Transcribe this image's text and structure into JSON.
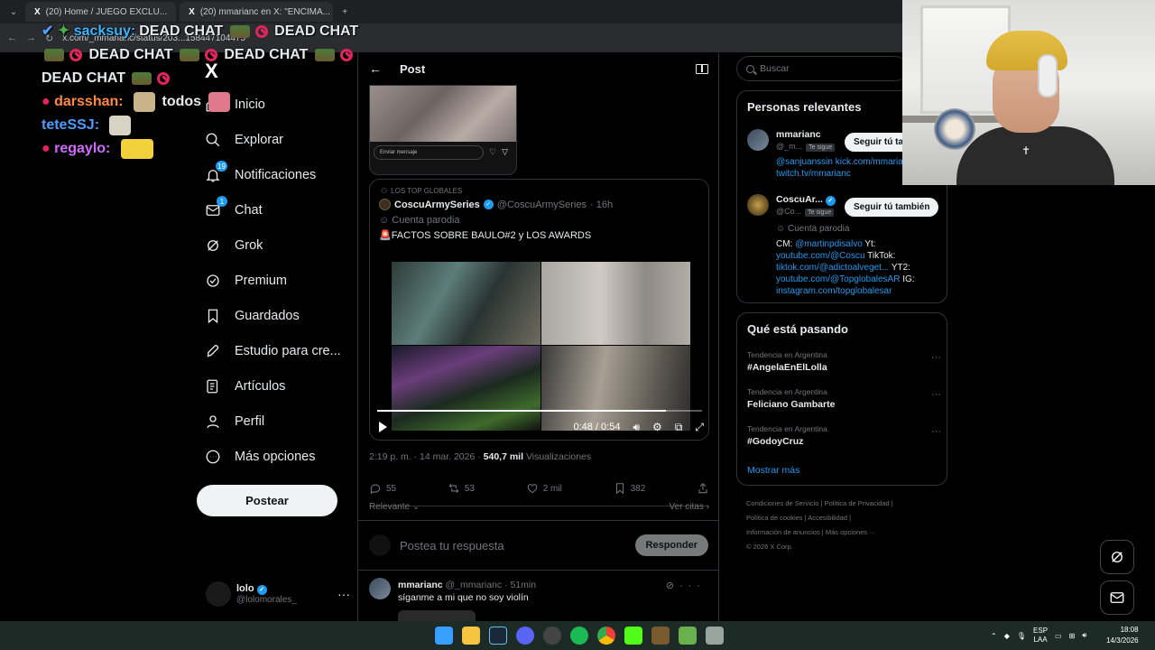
{
  "browser": {
    "tabs": [
      {
        "title": "(20) Home / JUEGO EXCLU..."
      },
      {
        "title": "(20) mmarianc en X: \"ENCIMA..."
      }
    ],
    "url": "x.com/_mmarianc/status/203...158447104475"
  },
  "chat_overlay": {
    "lines": [
      {
        "user": "sacksuy:",
        "user_color": "#3ab7ff",
        "text": "DEAD CHAT"
      },
      {
        "user": "darsshan:",
        "user_color": "#ff8a3d",
        "text": "todos"
      },
      {
        "user": "teteSSJ:",
        "user_color": "#4d9dff",
        "text": ""
      },
      {
        "user": "regaylo:",
        "user_color": "#d26bff",
        "text": ""
      }
    ],
    "spam_text": "DEAD CHAT"
  },
  "nav": {
    "logo": "X",
    "items": [
      {
        "label": "Inicio",
        "icon": "home-icon",
        "badge": ""
      },
      {
        "label": "Explorar",
        "icon": "search-icon",
        "badge": ""
      },
      {
        "label": "Notificaciones",
        "icon": "bell-icon",
        "badge": "19"
      },
      {
        "label": "Chat",
        "icon": "mail-icon",
        "badge": "1"
      },
      {
        "label": "Grok",
        "icon": "grok-icon",
        "badge": ""
      },
      {
        "label": "Premium",
        "icon": "verified-icon",
        "badge": ""
      },
      {
        "label": "Guardados",
        "icon": "bookmark-icon",
        "badge": ""
      },
      {
        "label": "Estudio para cre...",
        "icon": "rocket-icon",
        "badge": ""
      },
      {
        "label": "Artículos",
        "icon": "article-icon",
        "badge": ""
      },
      {
        "label": "Perfil",
        "icon": "person-icon",
        "badge": ""
      },
      {
        "label": "Más opciones",
        "icon": "more-circle-icon",
        "badge": ""
      }
    ],
    "post_button": "Postear",
    "profile": {
      "name": "lolo",
      "handle": "@lolomorales_"
    }
  },
  "main": {
    "header_title": "Post",
    "dm_preview": {
      "input_placeholder": "Enviar mensaje"
    },
    "quote": {
      "context": "LOS TOP GLOBALES",
      "name": "CoscuArmySeries",
      "handle": "@CoscuArmySeries",
      "time": "· 16h",
      "parody": "Cuenta parodia",
      "text": "🚨FACTOS SOBRE BAULO#2 y LOS AWARDS",
      "video_time": "0:48 / 0:54",
      "video_progress": 0.889
    },
    "meta": {
      "timestamp": "2:19 p. m. · 14 mar. 2026 · ",
      "views": "540,7 mil",
      "views_label": " Visualizaciones"
    },
    "actions": [
      {
        "icon": "reply-icon",
        "count": "55"
      },
      {
        "icon": "repost-icon",
        "count": "53"
      },
      {
        "icon": "like-icon",
        "count": "2 mil"
      },
      {
        "icon": "bookmark-icon",
        "count": "382"
      },
      {
        "icon": "share-icon",
        "count": ""
      }
    ],
    "sort_label": "Relevante",
    "quotes_link": "Ver citas",
    "reply_placeholder": "Postea tu respuesta",
    "reply_button": "Responder",
    "comment": {
      "name": "mmarianc",
      "handle": "@_mmarianc",
      "time": "· 51min",
      "text": "síganme a mi que no soy violín"
    }
  },
  "sidebar": {
    "search_placeholder": "Buscar",
    "relevant_title": "Personas relevantes",
    "people": [
      {
        "name": "mmarianc",
        "handle": "@_m...",
        "follows_you": "Te sigue",
        "button": "Seguir tú también",
        "bio_links": [
          "@sanjuanssin",
          "kick.com/mmarianc",
          "twitch.tv/mmarianc"
        ]
      },
      {
        "name": "CoscuAr...",
        "handle": "@Co...",
        "follows_you": "Te sigue",
        "button": "Seguir tú también",
        "parody": "Cuenta parodia",
        "bio": {
          "cm_label": "CM:",
          "cm_link": "@martinpdisalvo",
          "yt_label": "Yt:",
          "yt_link": "youtube.com/@Coscu",
          "tiktok_label": "TikTok:",
          "tiktok_link": "tiktok.com/@adictoalveget...",
          "yt2_label": "YT2:",
          "yt2_link": "youtube.com/@TopglobalesAR",
          "ig_label": "IG:",
          "ig_link": "instagram.com/topglobalesar"
        }
      }
    ],
    "trends_title": "Qué está pasando",
    "trends": [
      {
        "context": "Tendencia en Argentina",
        "name": "#AngelaEnElLolla"
      },
      {
        "context": "Tendencia en Argentina",
        "name": "Feliciano Gambarte"
      },
      {
        "context": "Tendencia en Argentina",
        "name": "#GodoyCruz"
      }
    ],
    "show_more": "Mostrar más",
    "footer": [
      "Condiciones de Servicio",
      "Política de Privacidad",
      "Política de cookies",
      "Accesibilidad",
      "Información de anuncios",
      "Más opciones ···",
      "© 2026 X Corp."
    ]
  },
  "taskbar": {
    "lang_top": "ESP",
    "lang_bottom": "LAA",
    "time": "18:08",
    "date": "14/3/2026"
  },
  "colors": {
    "accent": "#1d9bf0",
    "background": "#000000",
    "border": "#2f3336",
    "muted_text": "#71767b"
  }
}
